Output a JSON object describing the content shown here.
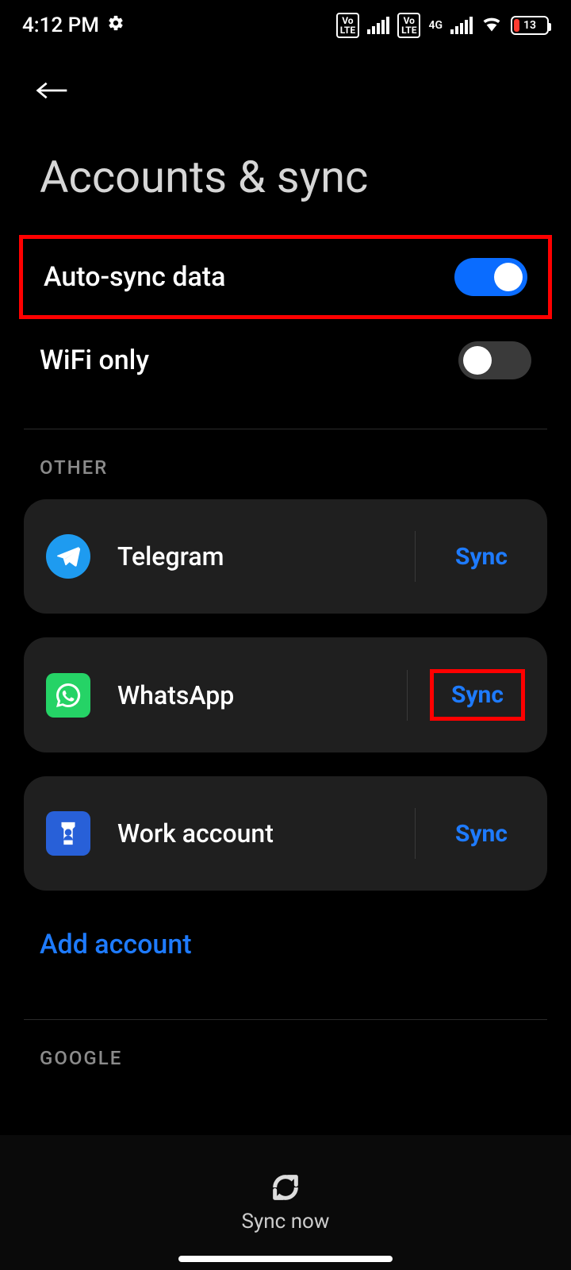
{
  "status_bar": {
    "time": "4:12 PM",
    "network_type": "4G",
    "battery_pct": "13"
  },
  "header": {
    "title": "Accounts & sync"
  },
  "toggles": {
    "auto_sync": {
      "label": "Auto-sync data",
      "on": true
    },
    "wifi_only": {
      "label": "WiFi only",
      "on": false
    }
  },
  "sections": {
    "other_label": "OTHER",
    "google_label": "GOOGLE"
  },
  "accounts": [
    {
      "name": "Telegram",
      "action": "Sync"
    },
    {
      "name": "WhatsApp",
      "action": "Sync"
    },
    {
      "name": "Work account",
      "action": "Sync"
    }
  ],
  "add_account_label": "Add account",
  "bottom_bar": {
    "sync_now": "Sync now"
  }
}
